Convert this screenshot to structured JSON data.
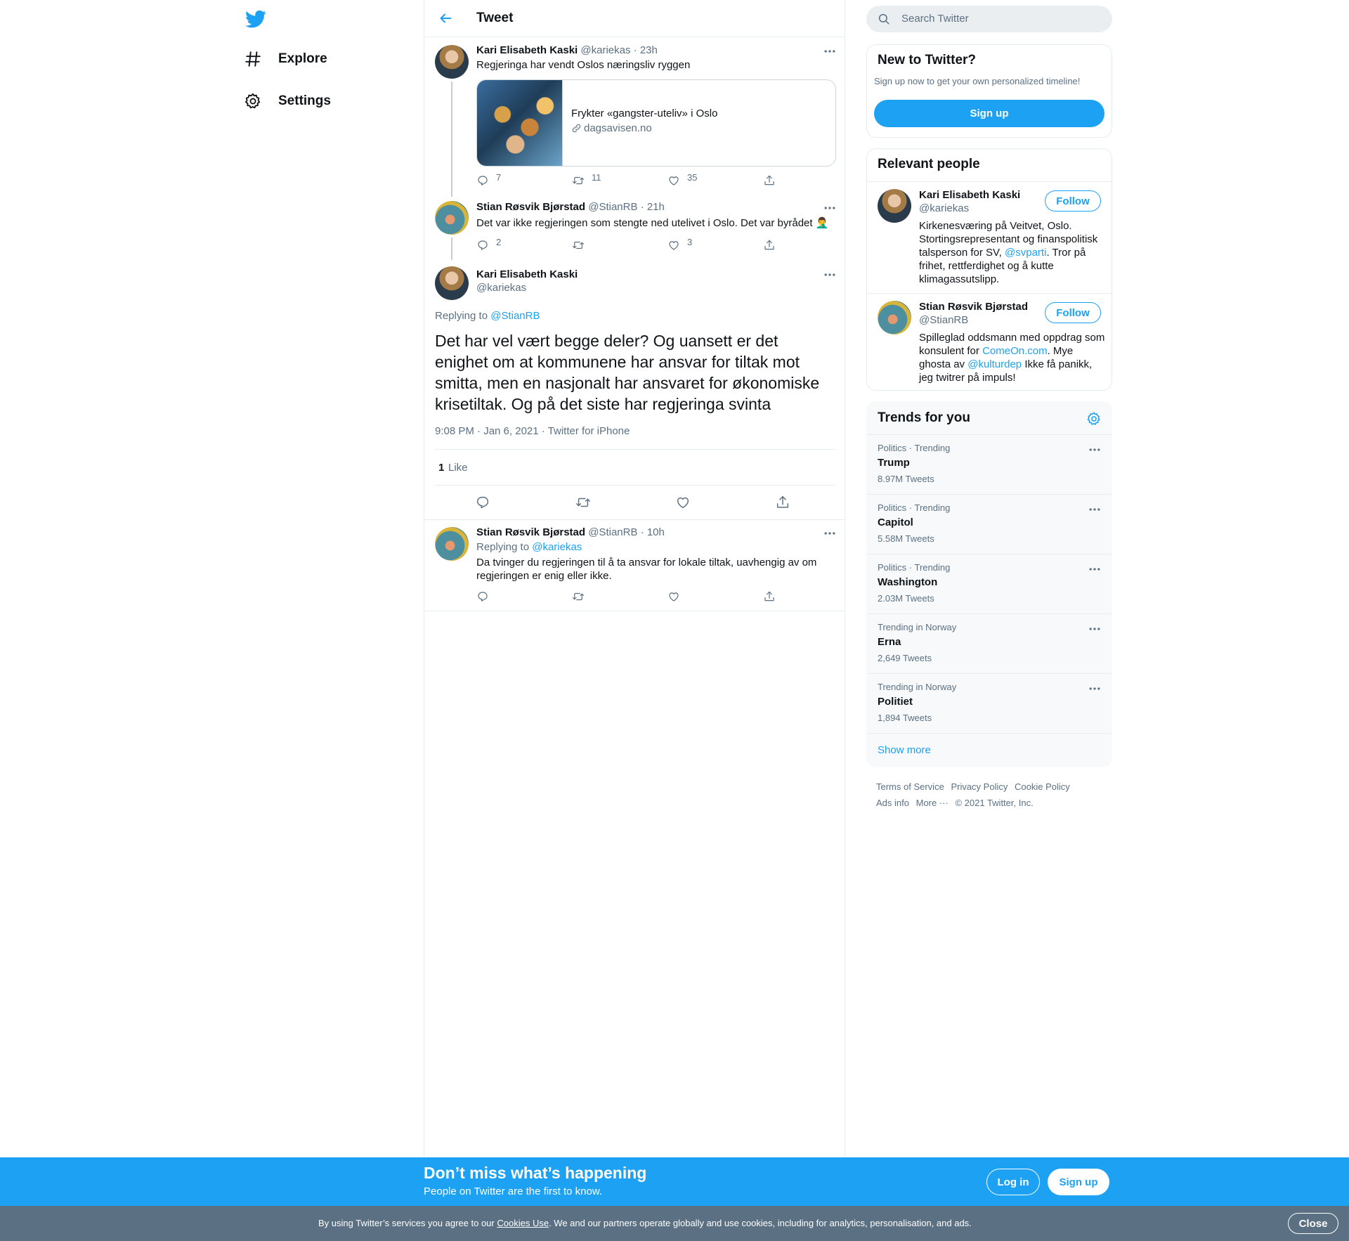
{
  "nav": {
    "logo_icon": "twitter-bird-icon",
    "items": [
      {
        "label": "Explore",
        "icon": "hashtag-icon"
      },
      {
        "label": "Settings",
        "icon": "gear-icon"
      }
    ]
  },
  "header": {
    "title": "Tweet",
    "back_icon": "arrow-left-icon"
  },
  "thread": [
    {
      "name": "Kari Elisabeth Kaski",
      "handle": "@kariekas",
      "time": "· 23h",
      "text": "Regjeringa har vendt Oslos næringsliv ryggen",
      "card": {
        "title": "Frykter «gangster-uteliv» i Oslo",
        "domain": "dagsavisen.no"
      },
      "replies": "7",
      "retweets": "11",
      "likes": "35"
    },
    {
      "name": "Stian Røsvik Bjørstad",
      "handle": "@StianRB",
      "time": "· 21h",
      "text": "Det var ikke regjeringen som stengte ned utelivet i Oslo. Det var byrådet 🤦‍♂️",
      "replies": "2",
      "retweets": "",
      "likes": "3"
    }
  ],
  "focus": {
    "name": "Kari Elisabeth Kaski",
    "handle": "@kariekas",
    "replying_prefix": "Replying to",
    "replying_to": "@StianRB",
    "text": "Det har vel vært begge deler? Og uansett er det enighet om at kommunene har ansvar for tiltak mot smitta, men en nasjonalt har ansvaret for økonomiske krisetiltak. Og på det siste har regjeringa svinta",
    "time": "9:08 PM · Jan 6, 2021 · Twitter for iPhone",
    "like_count": "1",
    "like_label": "Like"
  },
  "reply": {
    "name": "Stian Røsvik Bjørstad",
    "handle": "@StianRB",
    "time": "· 10h",
    "replying_prefix": "Replying to",
    "replying_to": "@kariekas",
    "text": "Da tvinger du regjeringen til å ta ansvar for lokale tiltak, uavhengig av om regjeringen er enig eller ikke."
  },
  "search": {
    "placeholder": "Search Twitter"
  },
  "new_to_twitter": {
    "title": "New to Twitter?",
    "subtitle": "Sign up now to get your own personalized timeline!",
    "button": "Sign up"
  },
  "relevant_people": {
    "title": "Relevant people",
    "people": [
      {
        "name": "Kari Elisabeth Kaski",
        "handle": "@kariekas",
        "follow": "Follow",
        "bio_1": "Kirkenesværing på Veitvet, Oslo. Stortingsrepresentant og finanspolitisk talsperson for SV, ",
        "bio_link_1": "@svparti",
        "bio_2": ". Tror på frihet, rettferdighet og å kutte klimagassutslipp."
      },
      {
        "name": "Stian Røsvik Bjørstad",
        "handle": "@StianRB",
        "follow": "Follow",
        "bio_1": "Spilleglad oddsmann med oppdrag som konsulent for ",
        "bio_link_1": "ComeOn.com",
        "bio_2": ". Mye ghosta av ",
        "bio_link_2": "@kulturdep",
        "bio_3": " Ikke få panikk, jeg twitrer på impuls!"
      }
    ]
  },
  "trends": {
    "title": "Trends for you",
    "items": [
      {
        "context": "Politics · Trending",
        "name": "Trump",
        "count": "8.97M Tweets"
      },
      {
        "context": "Politics · Trending",
        "name": "Capitol",
        "count": "5.58M Tweets"
      },
      {
        "context": "Politics · Trending",
        "name": "Washington",
        "count": "2.03M Tweets"
      },
      {
        "context": "Trending in Norway",
        "name": "Erna",
        "count": "2,649 Tweets"
      },
      {
        "context": "Trending in Norway",
        "name": "Politiet",
        "count": "1,894 Tweets"
      }
    ],
    "show_more": "Show more"
  },
  "footer": {
    "links": [
      "Terms of Service",
      "Privacy Policy",
      "Cookie Policy",
      "Ads info",
      "More ···"
    ],
    "copyright": "© 2021 Twitter, Inc."
  },
  "bottom_bar": {
    "title": "Don’t miss what’s happening",
    "subtitle": "People on Twitter are the first to know.",
    "login": "Log in",
    "signup": "Sign up"
  },
  "cookie_bar": {
    "text_1": "By using Twitter’s services you agree to our ",
    "link": "Cookies Use",
    "text_2": ". We and our partners operate globally and use cookies, including for analytics, personalisation, and ads.",
    "close": "Close"
  },
  "colors": {
    "accent": "#1da1f2",
    "secondary_text": "#5b7083",
    "cookie_bar": "#5b7083"
  }
}
